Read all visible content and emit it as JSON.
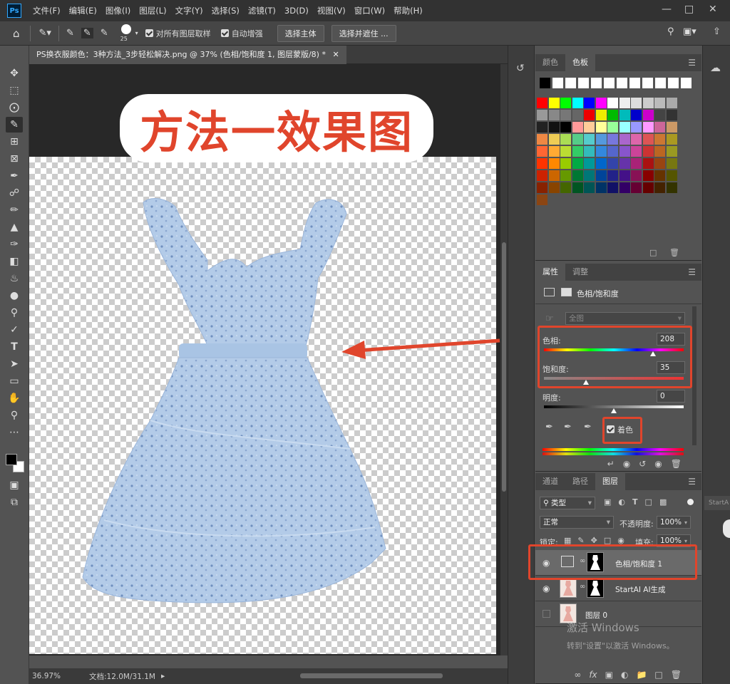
{
  "app": {
    "logo": "Ps"
  },
  "menu": [
    "文件(F)",
    "编辑(E)",
    "图像(I)",
    "图层(L)",
    "文字(Y)",
    "选择(S)",
    "滤镜(T)",
    "3D(D)",
    "视图(V)",
    "窗口(W)",
    "帮助(H)"
  ],
  "options": {
    "brush_size": "25",
    "sample_all_layers": "对所有图层取样",
    "auto_enhance": "自动增强",
    "select_subject": "选择主体",
    "select_mask": "选择并遮住 ..."
  },
  "document": {
    "tab_title": "PS换衣服颜色：3种方法_3步轻松解决.png @ 37% (色相/饱和度 1, 图层蒙版/8) *",
    "canvas_title": "方法一效果图"
  },
  "status": {
    "zoom": "36.97%",
    "doc_info": "文档:12.0M/31.1M"
  },
  "swatches_panel": {
    "tabs": [
      "颜色",
      "色板"
    ],
    "active": "色板"
  },
  "properties_panel": {
    "tabs": [
      "属性",
      "调整"
    ],
    "active": "属性",
    "adjustment_name": "色相/饱和度",
    "range": "全图",
    "hue_label": "色相:",
    "hue_value": "208",
    "saturation_label": "饱和度:",
    "saturation_value": "35",
    "lightness_label": "明度:",
    "lightness_value": "0",
    "colorize_label": "着色",
    "colorize_checked": true,
    "hue_fraction": 0.78,
    "saturation_fraction": 0.3,
    "lightness_fraction": 0.5
  },
  "layers_panel": {
    "tabs": [
      "通道",
      "路径",
      "图层"
    ],
    "active": "图层",
    "filter": "类型",
    "blend_mode": "正常",
    "opacity_label": "不透明度:",
    "opacity": "100%",
    "lock_label": "锁定:",
    "fill_label": "填充:",
    "fill": "100%",
    "layers": [
      {
        "name": "色相/饱和度 1",
        "visible": true,
        "selected": true
      },
      {
        "name": "StartAI AI生成",
        "visible": true,
        "selected": false
      },
      {
        "name": "图层 0",
        "visible": false,
        "selected": false
      }
    ]
  },
  "watermark": {
    "line1": "激活 Windows",
    "line2": "转到\"设置\"以激活 Windows。"
  },
  "side_tooltip": "StartA",
  "colors": {
    "accent": "#e0452c",
    "panel_bg": "#535353",
    "dark_bg": "#323232",
    "dress": "#a9c4e4"
  }
}
